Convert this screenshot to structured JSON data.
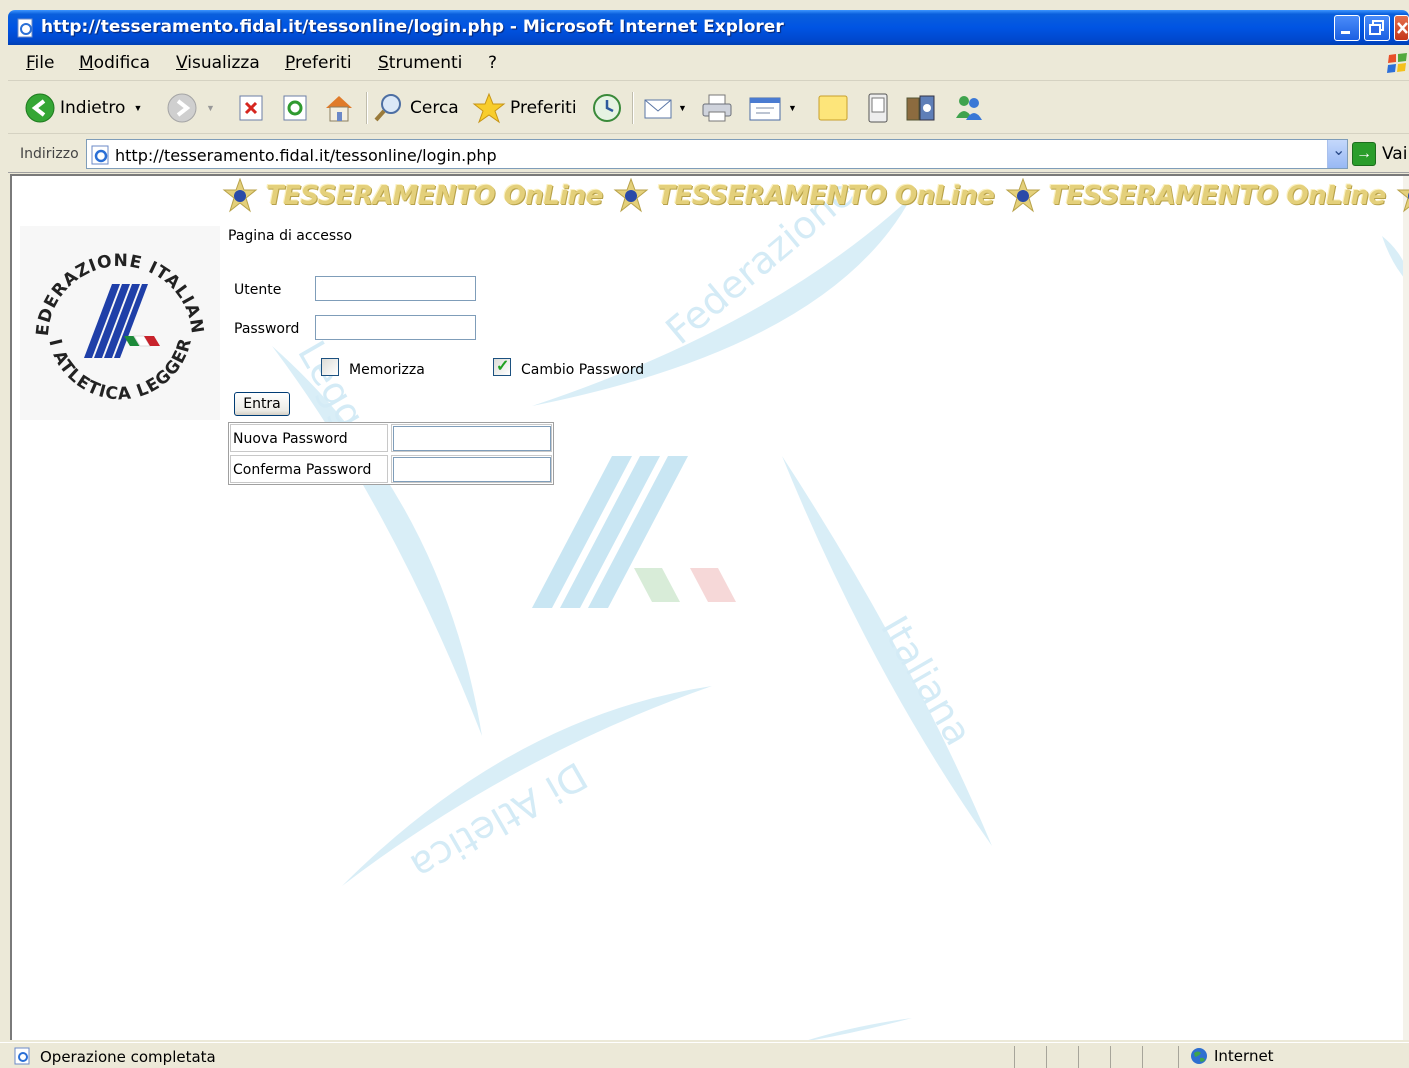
{
  "window": {
    "title": "http://tesseramento.fidal.it/tessonline/login.php - Microsoft Internet Explorer"
  },
  "menu": {
    "items": [
      "File",
      "Modifica",
      "Visualizza",
      "Preferiti",
      "Strumenti",
      "?"
    ]
  },
  "toolbar": {
    "back_label": "Indietro",
    "search_label": "Cerca",
    "favorites_label": "Preferiti"
  },
  "address": {
    "label": "Indirizzo",
    "url": "http://tesseramento.fidal.it/tessonline/login.php",
    "go_label": "Vai"
  },
  "page": {
    "banner_text": "TESSERAMENTO OnLine",
    "logo_text_top": "FEDERAZIONE ITALIANA",
    "logo_text_bottom": "DI ATLETICA LEGGERA",
    "watermark_words": [
      "Federazione",
      "Italiana",
      "Di Atletica",
      "Leggera"
    ],
    "heading": "Pagina di accesso",
    "user_label": "Utente",
    "user_value": "",
    "password_label": "Password",
    "password_value": "",
    "remember_label": "Memorizza",
    "remember_checked": false,
    "change_pw_label": "Cambio Password",
    "change_pw_checked": true,
    "submit_label": "Entra",
    "new_pw_label": "Nuova Password",
    "confirm_pw_label": "Conferma Password"
  },
  "status": {
    "text": "Operazione completata",
    "zone": "Internet"
  },
  "colors": {
    "title_bar": "#0054e3",
    "chrome": "#ece9d8",
    "banner_gold": "#e4d07b",
    "logo_blue": "#1f3fa8",
    "watermark_blue": "#d3ecf6"
  }
}
